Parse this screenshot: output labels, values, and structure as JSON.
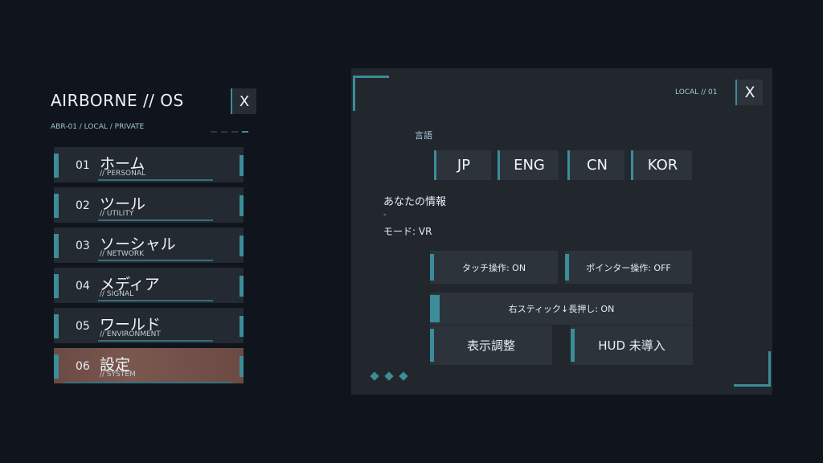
{
  "os": {
    "title": "AIRBORNE // OS",
    "path": "ABR-01 / LOCAL / PRIVATE",
    "close_label": "X"
  },
  "menu": {
    "items": [
      {
        "num": "01",
        "label": "ホーム",
        "sub": "// PERSONAL"
      },
      {
        "num": "02",
        "label": "ツール",
        "sub": "// UTILITY"
      },
      {
        "num": "03",
        "label": "ソーシャル",
        "sub": "// NETWORK"
      },
      {
        "num": "04",
        "label": "メディア",
        "sub": "// SIGNAL"
      },
      {
        "num": "05",
        "label": "ワールド",
        "sub": "// ENVIRONMENT"
      },
      {
        "num": "06",
        "label": "設定",
        "sub": "// SYSTEM"
      }
    ],
    "active_index": 5
  },
  "panel": {
    "local_label": "LOCAL // 01",
    "close_label": "X",
    "language_label": "言語",
    "languages": [
      "JP",
      "ENG",
      "CN",
      "KOR"
    ],
    "info_title": "あなたの情報",
    "info_dash": "-",
    "mode": "モード: VR",
    "touch": "タッチ操作: ON",
    "pointer": "ポインター操作: OFF",
    "stick": "右スティック↓長押し: ON",
    "display": "表示調整",
    "hud": "HUD 未導入"
  },
  "colors": {
    "accent": "#3b8d99",
    "background": "#10141c",
    "panel": "#22272e",
    "active_item": "#7a5850"
  }
}
